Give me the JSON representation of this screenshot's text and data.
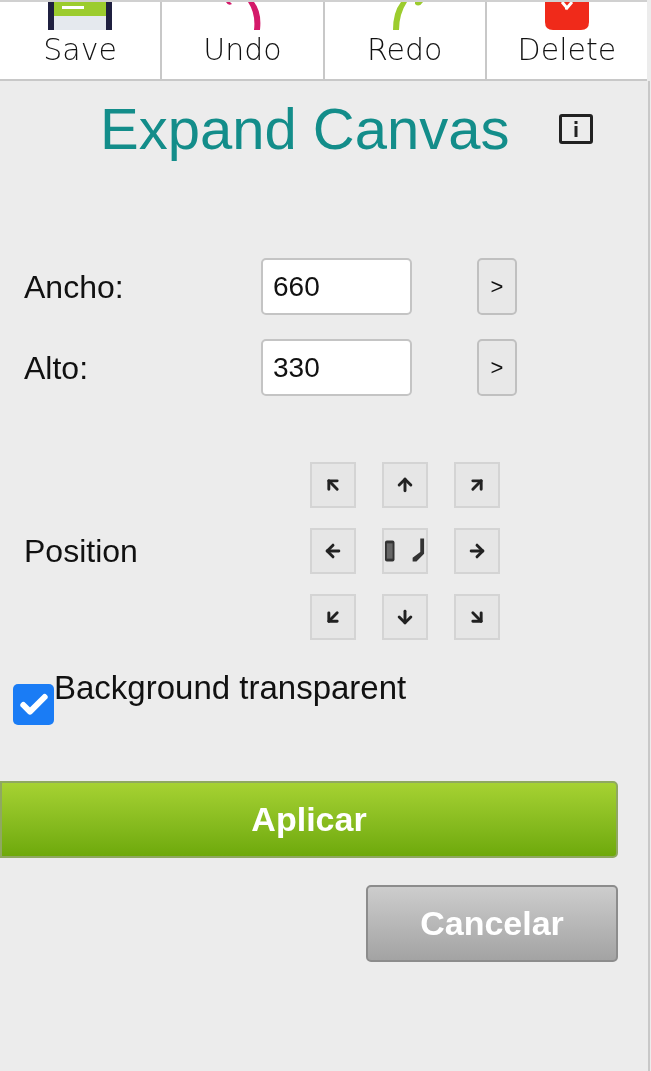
{
  "toolbar": [
    {
      "label": "Save",
      "kind": "save"
    },
    {
      "label": "Undo",
      "kind": "undo"
    },
    {
      "label": "Redo",
      "kind": "redo"
    },
    {
      "label": "Delete",
      "kind": "delete"
    }
  ],
  "title": "Expand Canvas",
  "fields": [
    {
      "label": "Ancho:",
      "value": "660",
      "button": ">"
    },
    {
      "label": "Alto:",
      "value": "330",
      "button": ">"
    }
  ],
  "position": {
    "label": "Position",
    "anchors": [
      {
        "kind": "nw"
      },
      {
        "kind": "n"
      },
      {
        "kind": "ne"
      },
      {
        "kind": "w"
      },
      {
        "kind": "center"
      },
      {
        "kind": "e"
      },
      {
        "kind": "sw"
      },
      {
        "kind": "s"
      },
      {
        "kind": "se"
      }
    ]
  },
  "background_transparent": {
    "label": "Background transparent",
    "checked": true
  },
  "apply_button": "Aplicar",
  "cancel_button": "Cancelar"
}
